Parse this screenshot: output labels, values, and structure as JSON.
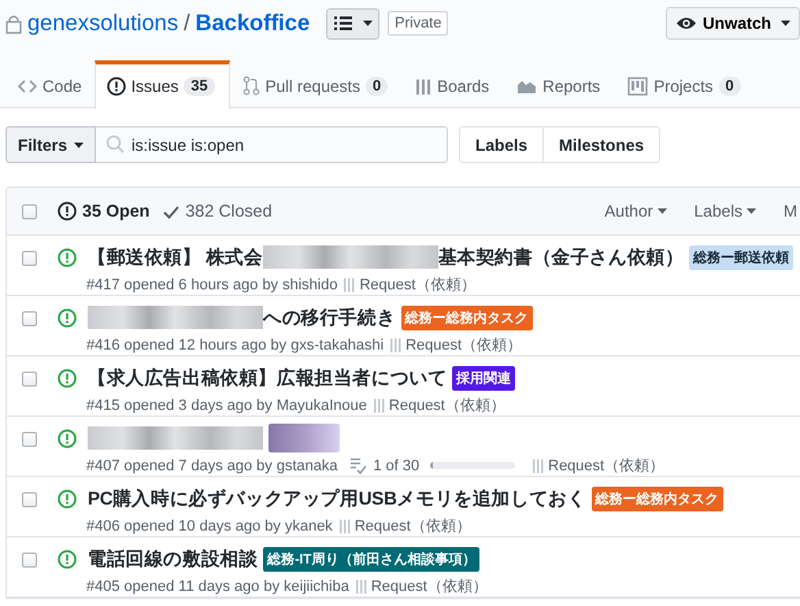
{
  "repo": {
    "owner": "genexsolutions",
    "separator": "/",
    "name": "Backoffice",
    "visibility": "Private",
    "watch_button": "Unwatch"
  },
  "tabs": [
    {
      "label": "Code",
      "selected": false
    },
    {
      "label": "Issues",
      "count": "35",
      "selected": true
    },
    {
      "label": "Pull requests",
      "count": "0",
      "selected": false
    },
    {
      "label": "Boards",
      "selected": false
    },
    {
      "label": "Reports",
      "selected": false
    },
    {
      "label": "Projects",
      "count": "0",
      "selected": false
    }
  ],
  "filter_bar": {
    "filters_button": "Filters",
    "search": {
      "value": "is:issue is:open"
    },
    "buttons": [
      "Labels",
      "Milestones"
    ]
  },
  "issues": {
    "header": {
      "checked": false,
      "open": "35 Open",
      "closed": "382 Closed",
      "menus": [
        "Author",
        "Labels",
        "M"
      ]
    },
    "rows": [
      {
        "checked": false,
        "title": [
          {
            "kind": "text",
            "text": "【郵送依頼】 株式会"
          },
          {
            "kind": "redacted"
          },
          {
            "kind": "text",
            "text": "基本契約書（金子さん依頼）"
          }
        ],
        "labels": [
          {
            "text": "総務ー郵送依頼",
            "color": "#c5def5"
          }
        ],
        "meta": "#417 opened 6 hours ago by shishido",
        "milestone": "Request（依頼）"
      },
      {
        "checked": false,
        "title": [
          {
            "kind": "redacted"
          },
          {
            "kind": "text",
            "text": "への移行手続き"
          }
        ],
        "labels": [
          {
            "text": "総務ー総務内タスク",
            "color": "#eb6420"
          }
        ],
        "meta": "#416 opened 12 hours ago by gxs-takahashi",
        "milestone": "Request（依頼）"
      },
      {
        "checked": false,
        "title": [
          {
            "kind": "text",
            "text": "【求人広告出稿依頼】広報担当者について"
          }
        ],
        "labels": [
          {
            "text": "採用関連",
            "color": "#5319e7"
          }
        ],
        "meta": "#415 opened 3 days ago by MayukaInoue",
        "milestone": "Request（依頼）"
      },
      {
        "checked": false,
        "title": [
          {
            "kind": "redacted"
          },
          {
            "kind": "redacted-label"
          }
        ],
        "labels": [],
        "meta": "#407 opened 7 days ago by gstanaka",
        "tasks": {
          "text": "1 of 30",
          "level": 0.033
        },
        "milestone": "Request（依頼）"
      },
      {
        "checked": false,
        "title": [
          {
            "kind": "text",
            "text": "PC購入時に必ずバックアップ用USBメモリを追加しておく"
          }
        ],
        "labels": [
          {
            "text": "総務ー総務内タスク",
            "color": "#eb6420"
          }
        ],
        "meta": "#406 opened 10 days ago by ykanek",
        "milestone": "Request（依頼）"
      },
      {
        "checked": false,
        "title": [
          {
            "kind": "text",
            "text": "電話回線の敷設相談"
          }
        ],
        "labels": [
          {
            "text": "総務-IT周り（前田さん相談事項）",
            "color": "#006b75"
          }
        ],
        "meta": "#405 opened 11 days ago by keijiichiba",
        "milestone": "Request（依頼）"
      }
    ]
  }
}
